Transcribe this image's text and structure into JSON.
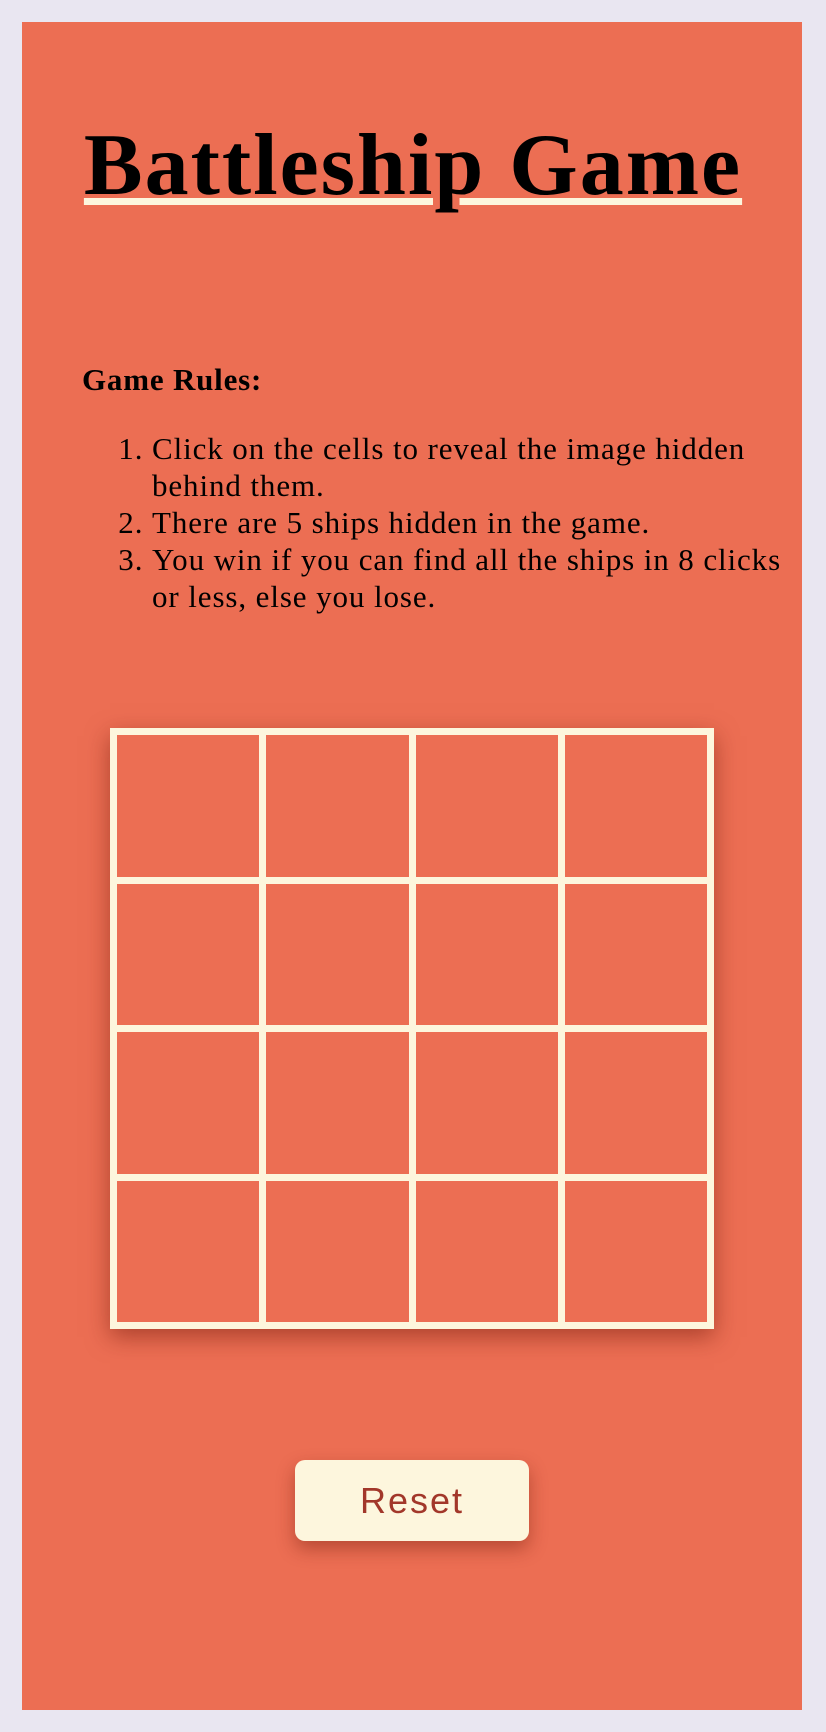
{
  "page": {
    "title": "Battleship Game"
  },
  "rules": {
    "heading": "Game Rules:",
    "items": [
      "Click on the cells to reveal the image hidden behind them.",
      "There are 5 ships hidden in the game.",
      "You win if you can find all the ships in 8 clicks or less, else you lose."
    ]
  },
  "board": {
    "rows": 4,
    "columns": 4
  },
  "controls": {
    "reset_label": "Reset"
  },
  "colors": {
    "page_background": "#e9e6f1",
    "panel_background": "#ec6e53",
    "accent_cream": "#fdf6dd",
    "button_text": "#a2372a"
  }
}
